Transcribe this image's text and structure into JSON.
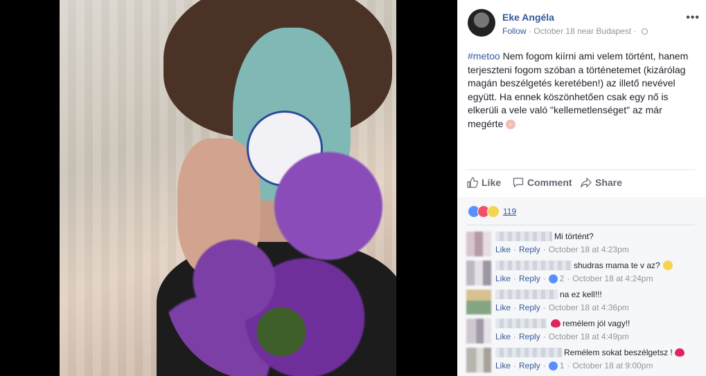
{
  "post": {
    "author": "Eke Angéla",
    "follow_label": "Follow",
    "meta_date": "October 18 near Budapest",
    "more_label": "•••",
    "hashtag": "#metoo",
    "text": " Nem fogom kiírni ami velem történt, hanem terjeszteni fogom szóban a történetemet (kizárólag magán beszélgetés keretében!) az illető nevével együtt. Ha ennek köszönhetően csak egy nő is elkerüli a vele való \"kellemetlenséget\" az már megérte "
  },
  "actions": {
    "like": "Like",
    "comment": "Comment",
    "share": "Share"
  },
  "reactions": {
    "icons": [
      "like-reaction-icon",
      "love-reaction-icon",
      "sad-reaction-icon"
    ],
    "count": "119"
  },
  "comments": [
    {
      "text": "Mi történt?",
      "like": "Like",
      "reply": "Reply",
      "likes": "",
      "time": "October 18 at 4:23pm",
      "emoji": ""
    },
    {
      "text": "shudras mama te v az?",
      "like": "Like",
      "reply": "Reply",
      "likes": "2",
      "time": "October 18 at 4:24pm",
      "emoji": "wow-emoji-icon"
    },
    {
      "text": "na ez kell!!!",
      "like": "Like",
      "reply": "Reply",
      "likes": "",
      "time": "October 18 at 4:36pm",
      "emoji": ""
    },
    {
      "text": "remélem jól vagy!!",
      "like": "Like",
      "reply": "Reply",
      "likes": "",
      "time": "October 18 at 4:49pm",
      "emoji": "heart-emoji-icon"
    },
    {
      "text": "Remélem sokat beszélgetsz !",
      "like": "Like",
      "reply": "Reply",
      "likes": "1",
      "time": "October 18 at 9:00pm",
      "emoji": "heart-emoji-icon"
    }
  ],
  "colors": {
    "link": "#365899",
    "meta": "#90949c",
    "text": "#1d2129",
    "background_comments": "#f6f7f9"
  }
}
